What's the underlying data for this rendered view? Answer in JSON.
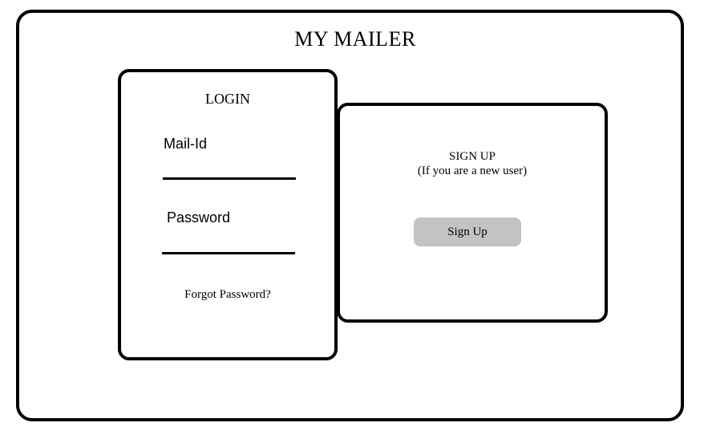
{
  "app": {
    "title": "MY MAILER"
  },
  "login": {
    "title": "LOGIN",
    "mail_label": "Mail-Id",
    "mail_value": "",
    "password_label": "Password",
    "password_value": "",
    "forgot_label": "Forgot Password?"
  },
  "signup": {
    "title": "SIGN UP",
    "subtitle": "(If you are a new user)",
    "button_label": "Sign Up",
    "button_color": "#c3c3c3"
  }
}
